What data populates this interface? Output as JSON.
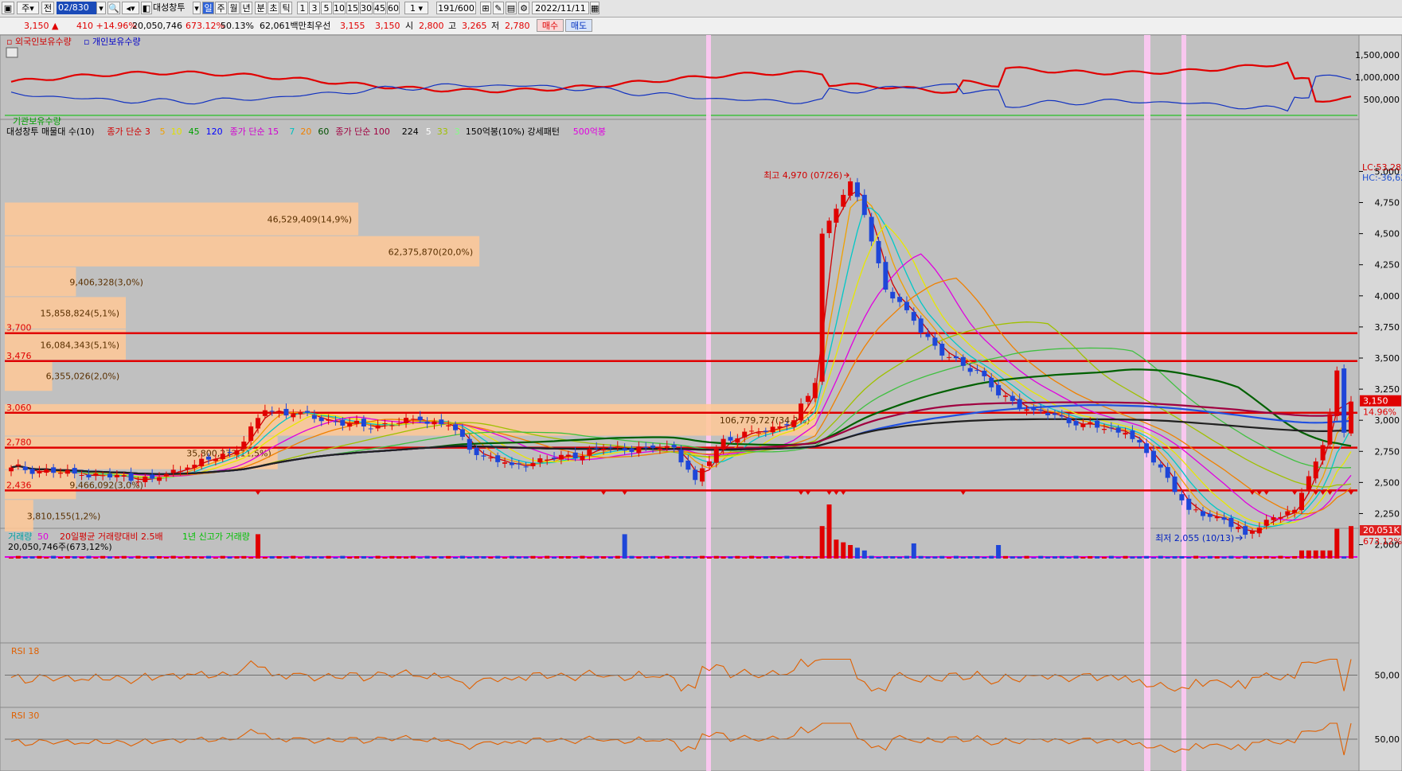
{
  "toolbar": {
    "items": [
      "주",
      "전",
      "02/830",
      "대성창투",
      "일",
      "주",
      "월",
      "년",
      "분",
      "초",
      "틱",
      "1",
      "3",
      "5",
      "10",
      "15",
      "30",
      "45",
      "60",
      "1",
      "191/600",
      "2022/11/11"
    ],
    "selected_period": "일"
  },
  "infobar": {
    "price": "3,150",
    "change": "410 +14.96%",
    "volume": "20,050,746",
    "volume_ratio": "673.12%",
    "ratio2": "50.13%",
    "amount": "62,061백만",
    "best_ask_label": "최우선",
    "best_ask": "3,155",
    "best_bid": "3,150",
    "open_label": "시",
    "open": "2,800",
    "high_label": "고",
    "high": "3,265",
    "low_label": "저",
    "low": "2,780",
    "buy_label": "매수",
    "sell_label": "매도"
  },
  "colors": {
    "up": "#e00000",
    "down": "#1e46d8",
    "bg": "#c0c0c0",
    "hline": "#e00000",
    "highlight": "#ffc8f4",
    "volume_profile": "#ffc896"
  },
  "panels": {
    "holdings": {
      "legend": [
        {
          "text": "외국인보유수량",
          "color": "#d00000"
        },
        {
          "text": "개인보유수량",
          "color": "#0000c8"
        }
      ],
      "ticks": [
        "1,500,000",
        "1,000,000",
        "500,000"
      ],
      "bottom_legend": "기관보유수량"
    },
    "price": {
      "legend": [
        {
          "text": "대성창투 매물대 수(10)",
          "color": "#000000"
        },
        {
          "text": "종가 단순 3",
          "color": "#d00000"
        },
        {
          "text": "5",
          "color": "#f0a000"
        },
        {
          "text": "10",
          "color": "#e0e000"
        },
        {
          "text": "45",
          "color": "#00a000"
        },
        {
          "text": "120",
          "color": "#0000ff"
        },
        {
          "text": "종가 단순 15",
          "color": "#d000d0"
        },
        {
          "text": "7",
          "color": "#00c0c0"
        },
        {
          "text": "20",
          "color": "#f08000"
        },
        {
          "text": "60",
          "color": "#005000"
        },
        {
          "text": "종가 단순 100",
          "color": "#a00040"
        },
        {
          "text": "224",
          "color": "#000000"
        },
        {
          "text": "5",
          "color": "#ffffff"
        },
        {
          "text": "33",
          "color": "#a0c000"
        },
        {
          "text": "3",
          "color": "#80ff80"
        },
        {
          "text": "150억봉(10%) 강세패턴",
          "color": "#000000"
        },
        {
          "text": "500억봉",
          "color": "#e000e0"
        }
      ],
      "lc": "LC:53,28",
      "hc": "HC:-36,62",
      "last_price": "3,150",
      "last_change": "14.96%",
      "max_label": "최고 4,970 (07/26)",
      "min_label": "최저 2,055 (10/13)",
      "ticks": [
        "5,000",
        "4,750",
        "4,500",
        "4,250",
        "4,000",
        "3,750",
        "3,500",
        "3,250",
        "3,000",
        "2,750",
        "2,500",
        "2,250",
        "2,000"
      ],
      "hlines": [
        {
          "price": 3700,
          "label": "3,700"
        },
        {
          "price": 3476,
          "label": "3,476"
        },
        {
          "price": 3060,
          "label": "3,060"
        },
        {
          "price": 2780,
          "label": "2,780"
        },
        {
          "price": 2436,
          "label": "2,436"
        }
      ]
    },
    "volume": {
      "legend": [
        {
          "text": "거래량",
          "color": "#00a0a0"
        },
        {
          "text": "50",
          "color": "#e000e0"
        },
        {
          "text": "20일평균 거래량대비 2.5배",
          "color": "#d00000"
        },
        {
          "text": "1년 신고가 거래량",
          "color": "#00c000"
        }
      ],
      "summary": "20,050,746주(673,12%)",
      "last_value": "20,051K",
      "last_pct": "673.12%"
    },
    "rsi18": {
      "legend": "RSI 18",
      "tick": "50,00"
    },
    "rsi30": {
      "legend": "RSI 30",
      "tick": "50,00"
    }
  },
  "chart_data": {
    "type": "candlestick",
    "x_count": 191,
    "price_range": [
      1850,
      5150
    ],
    "price_ticks": [
      5000,
      4750,
      4500,
      4250,
      4000,
      3750,
      3500,
      3250,
      3000,
      2750,
      2500,
      2250,
      2000
    ],
    "volume_profile": [
      {
        "low": 4480,
        "high": 4750,
        "volume": "46,529,409",
        "pct": "14.9%",
        "label": "46,529,409(14,9%)"
      },
      {
        "low": 4230,
        "high": 4480,
        "volume": "62,375,870",
        "pct": "20.0%",
        "label": "62,375,870(20,0%)"
      },
      {
        "low": 3990,
        "high": 4230,
        "volume": "9,406,328",
        "pct": "3.0%",
        "label": "9,406,328(3,0%)"
      },
      {
        "low": 3730,
        "high": 3990,
        "volume": "15,858,824",
        "pct": "5.1%",
        "label": "15,858,824(5,1%)"
      },
      {
        "low": 3480,
        "high": 3730,
        "volume": "16,084,343",
        "pct": "5.1%",
        "label": "16,084,343(5,1%)"
      },
      {
        "low": 3230,
        "high": 3480,
        "volume": "6,355,026",
        "pct": "2.0%",
        "label": "6,355,026(2,0%)"
      },
      {
        "low": 2870,
        "high": 3130,
        "volume": "106,779,727",
        "pct": "34.2%",
        "label": "106,779,727(34,2%)"
      },
      {
        "low": 2600,
        "high": 2870,
        "volume": "35,800,273",
        "pct": "11.5%",
        "label": "35,800,273(11,5%)"
      },
      {
        "low": 2360,
        "high": 2600,
        "volume": "9,466,092",
        "pct": "3.0%",
        "label": "9,466,092(3,0%)"
      },
      {
        "low": 2100,
        "high": 2360,
        "volume": "3,810,155",
        "pct": "1.2%",
        "label": "3,810,155(1,2%)"
      }
    ],
    "key_points": [
      {
        "index": 0,
        "close": 2620
      },
      {
        "index": 10,
        "close": 2560
      },
      {
        "index": 20,
        "close": 2530
      },
      {
        "index": 25,
        "close": 2620
      },
      {
        "index": 32,
        "close": 2760
      },
      {
        "index": 36,
        "close": 3080
      },
      {
        "index": 40,
        "close": 3050
      },
      {
        "index": 50,
        "close": 2950
      },
      {
        "index": 58,
        "close": 3000
      },
      {
        "index": 62,
        "close": 2960
      },
      {
        "index": 66,
        "close": 2720
      },
      {
        "index": 71,
        "close": 2640
      },
      {
        "index": 77,
        "close": 2690
      },
      {
        "index": 84,
        "close": 2770
      },
      {
        "index": 90,
        "close": 2780
      },
      {
        "index": 94,
        "close": 2780
      },
      {
        "index": 97,
        "close": 2520
      },
      {
        "index": 101,
        "close": 2850
      },
      {
        "index": 106,
        "close": 2900
      },
      {
        "index": 111,
        "close": 3000
      },
      {
        "index": 114,
        "close": 3300
      },
      {
        "index": 115,
        "close": 4500
      },
      {
        "index": 117,
        "close": 4700
      },
      {
        "index": 119,
        "close": 4920
      },
      {
        "index": 121,
        "close": 4650
      },
      {
        "index": 124,
        "close": 4050
      },
      {
        "index": 128,
        "close": 3800
      },
      {
        "index": 132,
        "close": 3520
      },
      {
        "index": 137,
        "close": 3400
      },
      {
        "index": 140,
        "close": 3200
      },
      {
        "index": 145,
        "close": 3080
      },
      {
        "index": 152,
        "close": 2970
      },
      {
        "index": 158,
        "close": 2900
      },
      {
        "index": 163,
        "close": 2620
      },
      {
        "index": 167,
        "close": 2280
      },
      {
        "index": 172,
        "close": 2200
      },
      {
        "index": 175,
        "close": 2080
      },
      {
        "index": 178,
        "close": 2200
      },
      {
        "index": 182,
        "close": 2280
      },
      {
        "index": 184,
        "close": 2550
      },
      {
        "index": 186,
        "close": 2800
      },
      {
        "index": 187,
        "close": 3050
      },
      {
        "index": 188,
        "close": 3400
      },
      {
        "index": 189,
        "close": 2900
      },
      {
        "index": 190,
        "close": 3150
      }
    ]
  }
}
